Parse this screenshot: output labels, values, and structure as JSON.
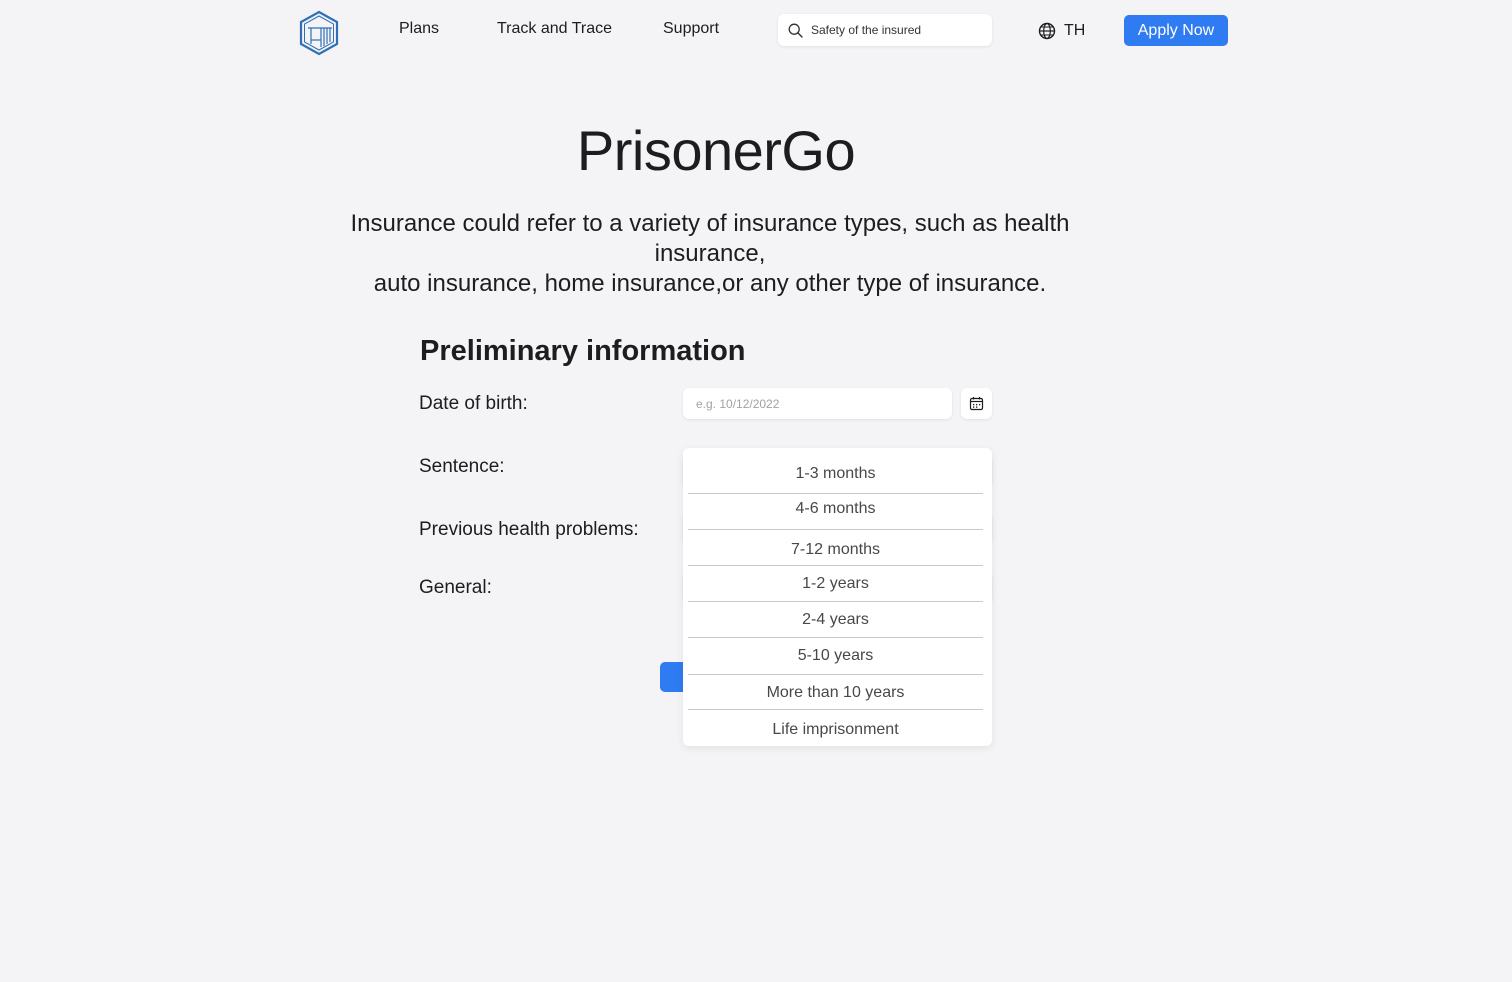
{
  "nav": {
    "links": [
      "Plans",
      "Track and Trace",
      "Support"
    ],
    "search_placeholder": "Safety of the insured",
    "language": "TH",
    "apply_label": "Apply Now"
  },
  "hero": {
    "title": "PrisonerGo",
    "subtitle_line1": "Insurance could refer to a variety of insurance types, such as health insurance,",
    "subtitle_line2": "auto insurance, home insurance,or any other type of insurance."
  },
  "form": {
    "title": "Preliminary information",
    "dob_label": "Date of birth:",
    "dob_placeholder": "e.g. 10/12/2022",
    "sentence_label": "Sentence:",
    "health_label": "Previous health problems:",
    "general_label": "General:"
  },
  "sentence_options": [
    "1-3 months",
    "4-6 months",
    "7-12 months",
    "1-2 years",
    "2-4 years",
    "5-10 years",
    "More than 10 years",
    "Life imprisonment"
  ],
  "colors": {
    "accent": "#2f7bf2",
    "background": "#f4f4f6",
    "logo": "#2e6fb8"
  }
}
